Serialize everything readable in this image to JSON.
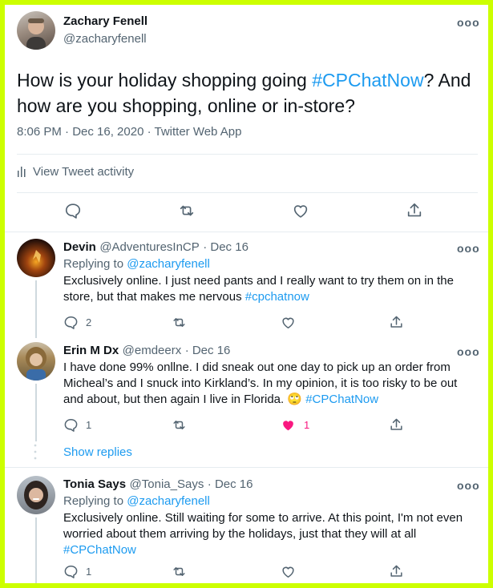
{
  "main": {
    "name": "Zachary Fenell",
    "handle": "@zacharyfenell",
    "text_before": "How is your holiday shopping going ",
    "hashtag": "#CPChatNow",
    "text_after": "? And how are you shopping, online or in-store?",
    "timestamp": "8:06 PM · Dec 16, 2020 · Twitter Web App",
    "activity": "View Tweet activity",
    "more": "ooo"
  },
  "replies": [
    {
      "name": "Devin",
      "handle": "@AdventuresInCP",
      "date": "· Dec 16",
      "replying_prefix": "Replying to ",
      "replying_to": "@zacharyfenell",
      "text": "Exclusively online. I just need pants and I really want to try them on in the store, but that makes me nervous ",
      "hashtag": "#cpchatnow",
      "reply_count": "2",
      "like_count": ""
    },
    {
      "name": "Erin M Dx",
      "handle": "@emdeerx",
      "date": "· Dec 16",
      "text": "I have done 99% onllne. I did sneak out one day to pick up an order from Micheal’s and I snuck into Kirkland’s. In my opinion, it is too risky to be out and about, but then again I live in Florida. ",
      "emoji": "🙄",
      "hashtag": "#CPChatNow",
      "reply_count": "1",
      "like_count": "1"
    },
    {
      "name": "Tonia Says",
      "handle": "@Tonia_Says",
      "date": "· Dec 16",
      "replying_prefix": "Replying to ",
      "replying_to": "@zacharyfenell",
      "text": "Exclusively online.  Still waiting for some to arrive.  At this point, I'm not even worried about them arriving by the holidays, just that they will at all",
      "hashtag": "#CPChatNow",
      "reply_count": "1",
      "like_count": ""
    }
  ],
  "show_replies": "Show replies",
  "colors": {
    "frame": "#ccff00",
    "link": "#1d9bf0",
    "muted": "#536471",
    "like_active": "#f91880"
  }
}
